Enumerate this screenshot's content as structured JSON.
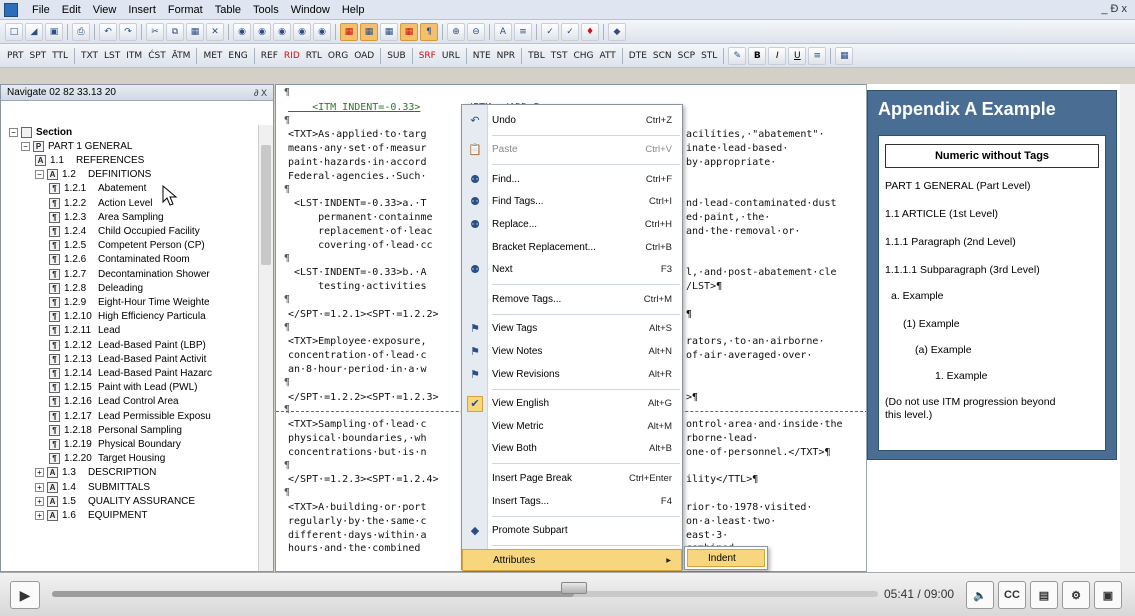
{
  "menubar": {
    "items": [
      "File",
      "Edit",
      "View",
      "Insert",
      "Format",
      "Table",
      "Tools",
      "Window",
      "Help"
    ],
    "window_controls": "_ Ɖ x"
  },
  "toolbar2": {
    "items": [
      "PRT",
      "SPT",
      "TTL",
      "TXT",
      "LST",
      "ITM",
      "ĆST",
      "ĀTM",
      "MET",
      "ENG",
      "REF",
      "RID",
      "RTL",
      "ORG",
      "OAD",
      "SUB",
      "SRF",
      "URL",
      "NTE",
      "NPR",
      "TBL",
      "TST",
      "CHG",
      "ATT",
      "DTE",
      "SCN",
      "SCP",
      "STL"
    ]
  },
  "nav": {
    "title": "Navigate 02 82 33.13 20",
    "controls": "∂ X",
    "tree": [
      {
        "level": 0,
        "badge": "",
        "num": "",
        "label": "Section"
      },
      {
        "level": 1,
        "badge": "P",
        "num": "",
        "label": "PART 1  GENERAL"
      },
      {
        "level": 2,
        "badge": "A",
        "num": "1.1",
        "label": "REFERENCES"
      },
      {
        "level": 2,
        "badge": "A",
        "num": "1.2",
        "label": "DEFINITIONS"
      },
      {
        "level": 3,
        "badge": "¶",
        "num": "1.2.1",
        "label": "Abatement"
      },
      {
        "level": 3,
        "badge": "¶",
        "num": "1.2.2",
        "label": "Action Level"
      },
      {
        "level": 3,
        "badge": "¶",
        "num": "1.2.3",
        "label": "Area Sampling"
      },
      {
        "level": 3,
        "badge": "¶",
        "num": "1.2.4",
        "label": "Child Occupied Facility"
      },
      {
        "level": 3,
        "badge": "¶",
        "num": "1.2.5",
        "label": "Competent Person (CP)"
      },
      {
        "level": 3,
        "badge": "¶",
        "num": "1.2.6",
        "label": "Contaminated Room"
      },
      {
        "level": 3,
        "badge": "¶",
        "num": "1.2.7",
        "label": "Decontamination Shower"
      },
      {
        "level": 3,
        "badge": "¶",
        "num": "1.2.8",
        "label": "Deleading"
      },
      {
        "level": 3,
        "badge": "¶",
        "num": "1.2.9",
        "label": "Eight-Hour Time Weighte"
      },
      {
        "level": 3,
        "badge": "¶",
        "num": "1.2.10",
        "label": "High Efficiency Particula"
      },
      {
        "level": 3,
        "badge": "¶",
        "num": "1.2.11",
        "label": "Lead"
      },
      {
        "level": 3,
        "badge": "¶",
        "num": "1.2.12",
        "label": "Lead-Based Paint (LBP)"
      },
      {
        "level": 3,
        "badge": "¶",
        "num": "1.2.13",
        "label": "Lead-Based Paint Activit"
      },
      {
        "level": 3,
        "badge": "¶",
        "num": "1.2.14",
        "label": "Lead-Based Paint Hazarc"
      },
      {
        "level": 3,
        "badge": "¶",
        "num": "1.2.15",
        "label": "Paint with Lead (PWL)"
      },
      {
        "level": 3,
        "badge": "¶",
        "num": "1.2.16",
        "label": "Lead Control Area"
      },
      {
        "level": 3,
        "badge": "¶",
        "num": "1.2.17",
        "label": "Lead Permissible Exposu"
      },
      {
        "level": 3,
        "badge": "¶",
        "num": "1.2.18",
        "label": "Personal Sampling"
      },
      {
        "level": 3,
        "badge": "¶",
        "num": "1.2.19",
        "label": "Physical Boundary"
      },
      {
        "level": 3,
        "badge": "¶",
        "num": "1.2.20",
        "label": "Target Housing"
      },
      {
        "level": 2,
        "badge": "A",
        "num": "1.3",
        "label": "DESCRIPTION"
      },
      {
        "level": 2,
        "badge": "A",
        "num": "1.4",
        "label": "SUBMITTALS"
      },
      {
        "level": 2,
        "badge": "A",
        "num": "1.5",
        "label": "QUALITY ASSURANCE"
      },
      {
        "level": 2,
        "badge": "A",
        "num": "1.6",
        "label": "EQUIPMENT"
      }
    ]
  },
  "editor": {
    "lines": [
      {
        "pil": "¶",
        "text": ""
      },
      {
        "pil": "",
        "text": "    <ITM INDENT=-0.33>",
        "tag": true,
        "after": "</ITM></ADD>¶"
      },
      {
        "pil": "¶",
        "text": ""
      },
      {
        "pil": "",
        "text": "<TXT>As·applied·to·targ",
        "after2": "acilities,·\"abatement\"·"
      },
      {
        "pil": "",
        "text": "means·any·set·of·measur",
        "after2": "inate·lead-based·"
      },
      {
        "pil": "",
        "text": "paint·hazards·in·accord",
        "after2": "by·appropriate·"
      },
      {
        "pil": "",
        "text": "Federal·agencies.·Such·"
      },
      {
        "pil": "¶",
        "text": ""
      },
      {
        "pil": "",
        "text": " <LST·INDENT=-0.33>a.·T",
        "after2": "nd·lead-contaminated·dust"
      },
      {
        "pil": "",
        "text": "     permanent·containme",
        "after2": "ed·paint,·the·"
      },
      {
        "pil": "",
        "text": "     replacement·of·leac",
        "after2": "and·the·removal·or·"
      },
      {
        "pil": "",
        "text": "     covering·of·lead·cc"
      },
      {
        "pil": "¶",
        "text": ""
      },
      {
        "pil": "",
        "text": " <LST·INDENT=-0.33>b.·A",
        "after2": "l,·and·post-abatement·cle"
      },
      {
        "pil": "",
        "text": "     testing·activities",
        "after2": "/LST>¶"
      },
      {
        "pil": "¶",
        "text": ""
      },
      {
        "pil": "",
        "text": "</SPT·=1.2.1><SPT·=1.2.2>",
        "after2": "¶"
      },
      {
        "pil": "¶",
        "text": ""
      },
      {
        "pil": "",
        "text": "<TXT>Employee·exposure,",
        "after2": "rators,·to·an·airborne·"
      },
      {
        "pil": "",
        "text": "concentration·of·lead·c",
        "after2": "of·air·averaged·over·"
      },
      {
        "pil": "",
        "text": "an·8·hour·period·in·a·w"
      },
      {
        "pil": "¶",
        "text": ""
      },
      {
        "pil": "",
        "text": "</SPT·=1.2.2><SPT·=1.2.3>",
        "after2": ">¶"
      },
      {
        "pil": "¶",
        "text": ""
      },
      {
        "pil": "",
        "text": "<TXT>Sampling·of·lead·c",
        "after2": "ontrol·area·and·inside·the"
      },
      {
        "pil": "",
        "text": "physical·boundaries,·wh",
        "after2": "rborne·lead·"
      },
      {
        "pil": "",
        "text": "concentrations·but·is·n",
        "after2": "one·of·personnel.</TXT>¶"
      },
      {
        "pil": "¶",
        "text": ""
      },
      {
        "pil": "",
        "text": "</SPT·=1.2.3><SPT·=1.2.4>",
        "after2": "ility</TTL>¶"
      },
      {
        "pil": "¶",
        "text": ""
      },
      {
        "pil": "",
        "text": "<TXT>A·building·or·port",
        "after2": "rior·to·1978·visited·"
      },
      {
        "pil": "",
        "text": "regularly·by·the·same·c",
        "after2": "on·a·least·two·"
      },
      {
        "pil": "",
        "text": "different·days·within·a",
        "after2": "east·3·"
      },
      {
        "pil": "",
        "text": "hours·and·the·combined",
        "after2": "combined·"
      }
    ]
  },
  "context_menu": {
    "items": [
      {
        "label": "Undo",
        "key": "Ctrl+Z",
        "icon": "undo-icon",
        "glyph": "↶",
        "dis": false
      },
      {
        "sep": true
      },
      {
        "label": "Paste",
        "key": "Ctrl+V",
        "icon": "paste-icon",
        "glyph": "📋",
        "dis": true
      },
      {
        "sep": true
      },
      {
        "label": "Find...",
        "key": "Ctrl+F",
        "icon": "find-icon",
        "glyph": "⚉",
        "dis": false
      },
      {
        "label": "Find Tags...",
        "key": "Ctrl+I",
        "icon": "find-tags-icon",
        "glyph": "⚉",
        "dis": false
      },
      {
        "label": "Replace...",
        "key": "Ctrl+H",
        "icon": "replace-icon",
        "glyph": "⚉",
        "dis": false
      },
      {
        "label": "Bracket Replacement...",
        "key": "Ctrl+B",
        "icon": "",
        "glyph": "",
        "dis": false
      },
      {
        "label": "Next",
        "key": "F3",
        "icon": "next-icon",
        "glyph": "⚉",
        "dis": false
      },
      {
        "sep": true
      },
      {
        "label": "Remove Tags...",
        "key": "Ctrl+M",
        "icon": "",
        "glyph": "",
        "dis": false
      },
      {
        "sep": true
      },
      {
        "label": "View Tags",
        "key": "Alt+S",
        "icon": "view-tags-icon",
        "glyph": "⚑",
        "dis": false
      },
      {
        "label": "View Notes",
        "key": "Alt+N",
        "icon": "view-notes-icon",
        "glyph": "⚑",
        "dis": false
      },
      {
        "label": "View Revisions",
        "key": "Alt+R",
        "icon": "view-revisions-icon",
        "glyph": "⚑",
        "dis": false
      },
      {
        "sep": true
      },
      {
        "label": "View English",
        "key": "Alt+G",
        "icon": "checkmark-icon",
        "glyph": "✔",
        "dis": false,
        "checked": true
      },
      {
        "label": "View Metric",
        "key": "Alt+M",
        "icon": "",
        "glyph": "",
        "dis": false
      },
      {
        "label": "View Both",
        "key": "Alt+B",
        "icon": "",
        "glyph": "",
        "dis": false
      },
      {
        "sep": true
      },
      {
        "label": "Insert Page Break",
        "key": "Ctrl+Enter",
        "icon": "",
        "glyph": "",
        "dis": false
      },
      {
        "label": "Insert Tags...",
        "key": "F4",
        "icon": "",
        "glyph": "",
        "dis": false
      },
      {
        "sep": true
      },
      {
        "label": "Promote Subpart",
        "key": "",
        "icon": "promote-icon",
        "glyph": "◆",
        "dis": false
      },
      {
        "sep": true
      },
      {
        "label": "Attributes",
        "key": "▸",
        "icon": "",
        "glyph": "",
        "dis": false,
        "selected": true
      }
    ]
  },
  "submenu": {
    "label": "Indent"
  },
  "preview": {
    "title": "Appendix A Example",
    "heading": "Numeric without Tags",
    "lines": [
      "PART 1  GENERAL (Part Level)",
      "1.1  ARTICLE (1st Level)",
      "1.1.1  Paragraph (2nd Level)",
      "1.1.1.1  Subparagraph (3rd Level)",
      "a.  Example",
      "(1) Example",
      "(a) Example",
      "1.  Example",
      "(Do not use ITM progression beyond",
      "this level.)"
    ]
  },
  "player": {
    "time": "05:41 / 09:00",
    "progress": 0.632,
    "cc_label": "CC"
  },
  "colors": {
    "appendix_box": "#4a6d93",
    "menu_highlight": "#f7d67e"
  }
}
